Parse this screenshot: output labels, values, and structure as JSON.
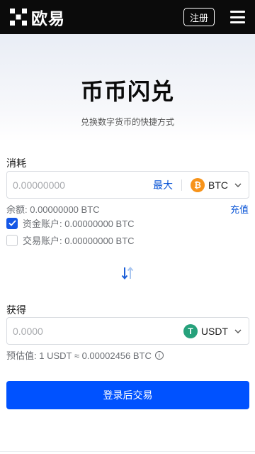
{
  "header": {
    "brand": "欧易",
    "register_label": "注册"
  },
  "hero": {
    "title": "币币闪兑",
    "subtitle": "兑换数字货币的快捷方式"
  },
  "spend": {
    "label": "消耗",
    "placeholder": "0.00000000",
    "max_label": "最大",
    "coin": "BTC",
    "coin_glyph": "₿",
    "balance": "余额: 0.00000000 BTC",
    "deposit_label": "充值",
    "funding_account": "资金账户: 0.00000000 BTC",
    "funding_checked": true,
    "trading_account": "交易账户: 0.00000000 BTC",
    "trading_checked": false
  },
  "receive": {
    "label": "获得",
    "placeholder": "0.0000",
    "coin": "USDT",
    "coin_glyph": "T",
    "estimate": "预估值: 1 USDT ≈ 0.00002456 BTC"
  },
  "action": {
    "login_label": "登录后交易"
  },
  "colors": {
    "primary": "#0052ff",
    "link": "#0a55d6",
    "btc": "#f7931a",
    "usdt": "#26a17b",
    "topbar": "#0b0b0b"
  },
  "icons": {
    "logo": "okx-logo-icon",
    "menu": "hamburger-menu-icon",
    "swap": "swap-arrows-icon",
    "chevron": "chevron-down-icon",
    "info": "info-icon",
    "check": "check-icon"
  }
}
